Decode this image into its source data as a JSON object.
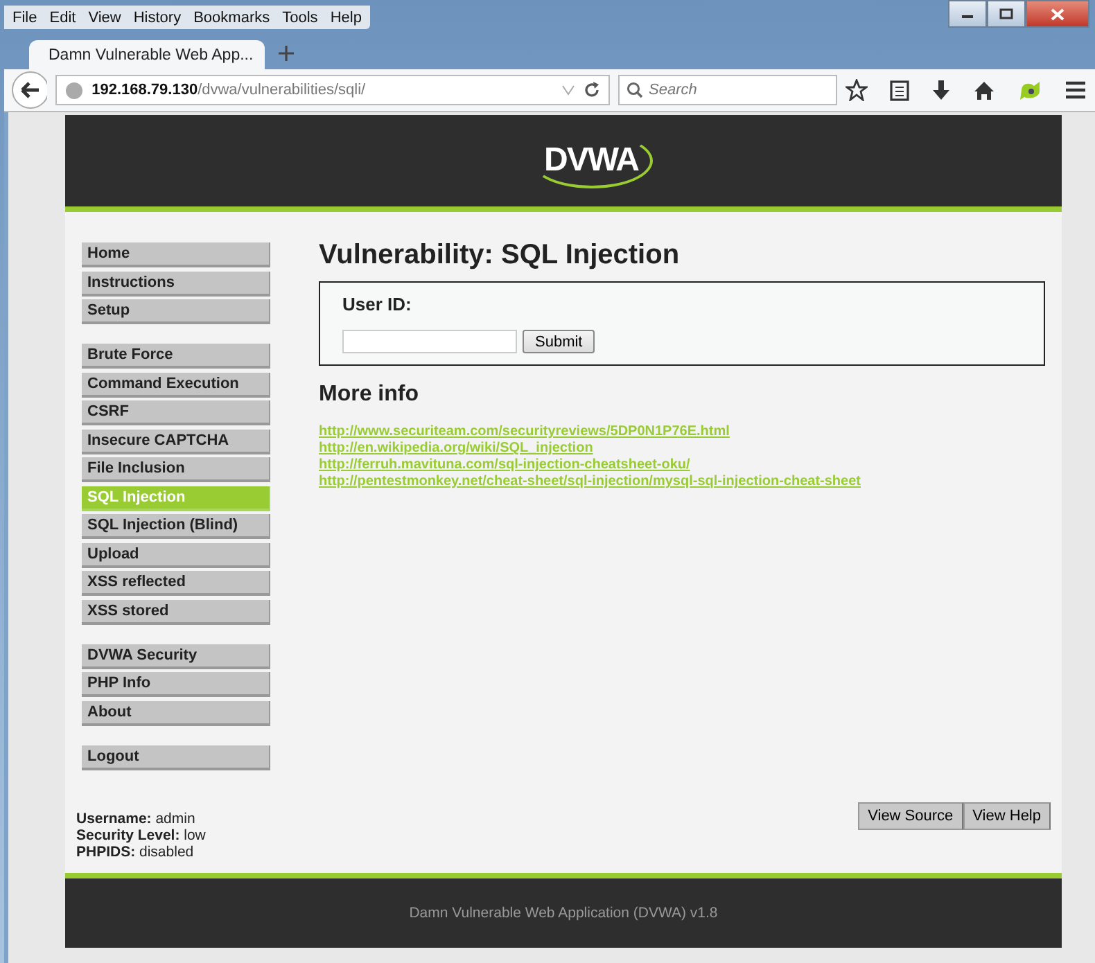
{
  "menubar": [
    "File",
    "Edit",
    "View",
    "History",
    "Bookmarks",
    "Tools",
    "Help"
  ],
  "tabs": [
    {
      "title": "Damn Vulnerable Web App...",
      "selected": true
    }
  ],
  "navbar": {
    "url_host": "192.168.79.130",
    "url_path": "/dvwa/vulnerabilities/sqli/",
    "search_placeholder": "Search"
  },
  "header": {
    "logo": "DVWA"
  },
  "menu_groups": [
    {
      "items": [
        {
          "label": "Home",
          "selected": false
        },
        {
          "label": "Instructions",
          "selected": false
        },
        {
          "label": "Setup",
          "selected": false
        }
      ]
    },
    {
      "items": [
        {
          "label": "Brute Force",
          "selected": false
        },
        {
          "label": "Command Execution",
          "selected": false
        },
        {
          "label": "CSRF",
          "selected": false
        },
        {
          "label": "Insecure CAPTCHA",
          "selected": false
        },
        {
          "label": "File Inclusion",
          "selected": false
        },
        {
          "label": "SQL Injection",
          "selected": true
        },
        {
          "label": "SQL Injection (Blind)",
          "selected": false
        },
        {
          "label": "Upload",
          "selected": false
        },
        {
          "label": "XSS reflected",
          "selected": false
        },
        {
          "label": "XSS stored",
          "selected": false
        }
      ]
    },
    {
      "items": [
        {
          "label": "DVWA Security",
          "selected": false
        },
        {
          "label": "PHP Info",
          "selected": false
        },
        {
          "label": "About",
          "selected": false
        }
      ]
    },
    {
      "items": [
        {
          "label": "Logout",
          "selected": false
        }
      ]
    }
  ],
  "main": {
    "title": "Vulnerability: SQL Injection",
    "form": {
      "label": "User ID:",
      "button": "Submit"
    },
    "more_info_title": "More info",
    "links": [
      "http://www.securiteam.com/securityreviews/5DP0N1P76E.html",
      "http://en.wikipedia.org/wiki/SQL_injection",
      "http://ferruh.mavituna.com/sql-injection-cheatsheet-oku/",
      "http://pentestmonkey.net/cheat-sheet/sql-injection/mysql-sql-injection-cheat-sheet"
    ]
  },
  "status": [
    {
      "key": "Username:",
      "value": "admin"
    },
    {
      "key": "Security Level:",
      "value": "low"
    },
    {
      "key": "PHPIDS:",
      "value": "disabled"
    }
  ],
  "buttons": [
    "View Source",
    "View Help"
  ],
  "footer": "Damn Vulnerable Web Application (DVWA) v1.8"
}
